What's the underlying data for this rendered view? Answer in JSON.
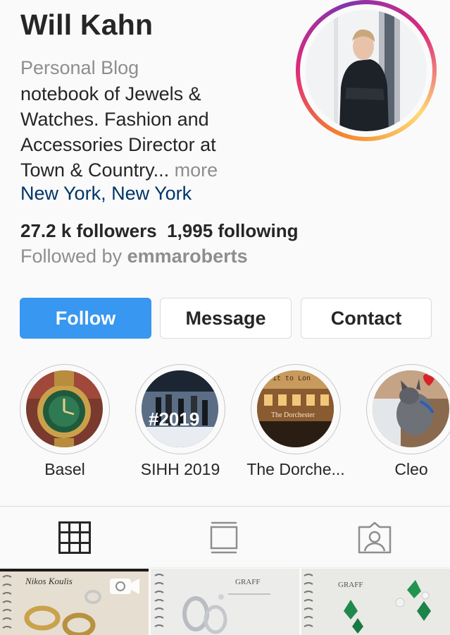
{
  "profile": {
    "name": "Will Kahn",
    "category": "Personal Blog",
    "bio_lines": [
      "notebook of Jewels &",
      "Watches.  Fashion and",
      "Accessories Director at",
      "Town & Country..."
    ],
    "more": "more",
    "location": "New York, New York",
    "followers": "27.2 k followers",
    "following": "1,995 following",
    "followed_by_prefix": "Followed by",
    "followed_by_user": "emmaroberts"
  },
  "buttons": {
    "follow": "Follow",
    "message": "Message",
    "contact": "Contact"
  },
  "highlights": [
    {
      "label": "Basel"
    },
    {
      "label": "SIHH 2019"
    },
    {
      "label": "The Dorche..."
    },
    {
      "label": "Cleo"
    }
  ],
  "highlight_text": {
    "sihh_tag": "#2019",
    "dorchester_sign": "The Dorchester",
    "dorchester_top": "it to Lon"
  },
  "tabs": [
    "grid-icon",
    "feed-icon",
    "tagged-icon"
  ],
  "posts": {
    "p1_note": "Nikos Koulis",
    "p2_note": "GRAFF",
    "p3_note": "GRAFF"
  },
  "colors": {
    "accent": "#3897f0",
    "location": "#003569",
    "secondary": "#8e8e8e"
  }
}
